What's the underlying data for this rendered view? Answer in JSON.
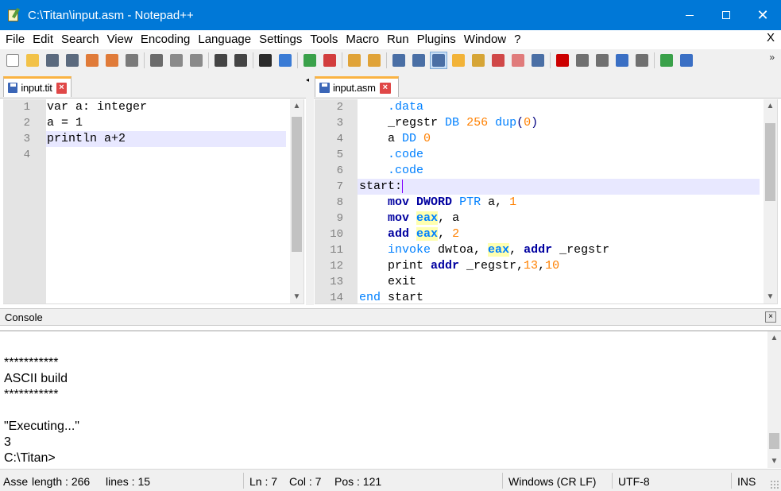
{
  "window": {
    "title": "C:\\Titan\\input.asm - Notepad++"
  },
  "menu": [
    "File",
    "Edit",
    "Search",
    "View",
    "Encoding",
    "Language",
    "Settings",
    "Tools",
    "Macro",
    "Run",
    "Plugins",
    "Window",
    "?"
  ],
  "menu_close": "X",
  "toolbar": {
    "more": "»",
    "buttons": [
      {
        "name": "new-file-icon",
        "color": "#ffffff"
      },
      {
        "name": "open-file-icon",
        "color": "#f2c248"
      },
      {
        "name": "save-icon",
        "color": "#5b6a7e"
      },
      {
        "name": "save-all-icon",
        "color": "#5b6a7e"
      },
      {
        "name": "close-icon",
        "color": "#e07b39"
      },
      {
        "name": "close-all-icon",
        "color": "#e07b39"
      },
      {
        "name": "print-icon",
        "color": "#7a7a7a"
      },
      {
        "name": "cut-icon",
        "color": "#6b6b6b"
      },
      {
        "name": "copy-icon",
        "color": "#8a8a8a"
      },
      {
        "name": "paste-icon",
        "color": "#8a8a8a"
      },
      {
        "name": "undo-icon",
        "color": "#444444"
      },
      {
        "name": "redo-icon",
        "color": "#444444"
      },
      {
        "name": "find-icon",
        "color": "#2b2b2b"
      },
      {
        "name": "replace-icon",
        "color": "#3a7bd5"
      },
      {
        "name": "zoom-in-icon",
        "color": "#3aa14a"
      },
      {
        "name": "zoom-out-icon",
        "color": "#d23d3d"
      },
      {
        "name": "sync-vertical-icon",
        "color": "#e0a338"
      },
      {
        "name": "sync-horizontal-icon",
        "color": "#e0a338"
      },
      {
        "name": "word-wrap-icon",
        "color": "#4a6fa5"
      },
      {
        "name": "show-all-characters-icon",
        "color": "#4a6fa5"
      },
      {
        "name": "indent-guide-icon",
        "color": "#4a6fa5"
      },
      {
        "name": "doc-map-icon",
        "color": "#f2b338"
      },
      {
        "name": "function-list-icon",
        "color": "#d6a536"
      },
      {
        "name": "udl-icon",
        "color": "#d04848"
      },
      {
        "name": "folder-workspace-icon",
        "color": "#e07b7b"
      },
      {
        "name": "monitoring-icon",
        "color": "#4a6fa5"
      },
      {
        "name": "record-macro-icon",
        "color": "#cc0000"
      },
      {
        "name": "stop-macro-icon",
        "color": "#707070"
      },
      {
        "name": "play-macro-icon",
        "color": "#707070"
      },
      {
        "name": "run-macro-multiple-icon",
        "color": "#3a6fc4"
      },
      {
        "name": "save-macro-icon",
        "color": "#707070"
      },
      {
        "name": "run-icon",
        "color": "#3aa14a"
      },
      {
        "name": "plugin-icon",
        "color": "#3a6fc4"
      }
    ]
  },
  "left_tab": {
    "label": "input.tit",
    "close": "×"
  },
  "right_tab": {
    "label": "input.asm",
    "close": "×"
  },
  "left_editor": {
    "lines": [
      {
        "n": "1",
        "text": "var a: integer"
      },
      {
        "n": "2",
        "text": "a = 1"
      },
      {
        "n": "3",
        "text": "println a+2"
      },
      {
        "n": "4",
        "text": ""
      }
    ]
  },
  "right_editor": {
    "lines": [
      {
        "n": "2",
        "tokens": [
          {
            "t": "    "
          },
          {
            "t": ".data",
            "c": "kw-blue"
          }
        ]
      },
      {
        "n": "3",
        "tokens": [
          {
            "t": "    _regstr "
          },
          {
            "t": "DB",
            "c": "kw-blue"
          },
          {
            "t": " "
          },
          {
            "t": "256",
            "c": "num"
          },
          {
            "t": " "
          },
          {
            "t": "dup",
            "c": "kw-blue"
          },
          {
            "t": "(",
            "c": "punct"
          },
          {
            "t": "0",
            "c": "num"
          },
          {
            "t": ")",
            "c": "punct"
          }
        ]
      },
      {
        "n": "4",
        "tokens": [
          {
            "t": "    a "
          },
          {
            "t": "DD",
            "c": "kw-blue"
          },
          {
            "t": " "
          },
          {
            "t": "0",
            "c": "num"
          }
        ]
      },
      {
        "n": "5",
        "tokens": [
          {
            "t": "    "
          },
          {
            "t": ".code",
            "c": "kw-blue"
          }
        ]
      },
      {
        "n": "6",
        "tokens": [
          {
            "t": "    "
          },
          {
            "t": ".code",
            "c": "kw-blue"
          }
        ]
      },
      {
        "n": "7",
        "tokens": [
          {
            "t": "start:"
          }
        ]
      },
      {
        "n": "8",
        "tokens": [
          {
            "t": "    "
          },
          {
            "t": "mov",
            "c": "kw-bold"
          },
          {
            "t": " "
          },
          {
            "t": "DWORD",
            "c": "kw-bold"
          },
          {
            "t": " "
          },
          {
            "t": "PTR",
            "c": "kw-blue"
          },
          {
            "t": " a, "
          },
          {
            "t": "1",
            "c": "num"
          }
        ]
      },
      {
        "n": "9",
        "tokens": [
          {
            "t": "    "
          },
          {
            "t": "mov",
            "c": "kw-bold"
          },
          {
            "t": " "
          },
          {
            "t": "eax",
            "c": "reg"
          },
          {
            "t": ", a"
          }
        ]
      },
      {
        "n": "10",
        "tokens": [
          {
            "t": "    "
          },
          {
            "t": "add",
            "c": "kw-bold"
          },
          {
            "t": " "
          },
          {
            "t": "eax",
            "c": "reg"
          },
          {
            "t": ", "
          },
          {
            "t": "2",
            "c": "num"
          }
        ]
      },
      {
        "n": "11",
        "tokens": [
          {
            "t": "    "
          },
          {
            "t": "invoke",
            "c": "kw-blue"
          },
          {
            "t": " dwtoa, "
          },
          {
            "t": "eax",
            "c": "reg"
          },
          {
            "t": ", "
          },
          {
            "t": "addr",
            "c": "kw-bold"
          },
          {
            "t": " _regstr"
          }
        ]
      },
      {
        "n": "12",
        "tokens": [
          {
            "t": "    print "
          },
          {
            "t": "addr",
            "c": "kw-bold"
          },
          {
            "t": " _regstr,"
          },
          {
            "t": "13",
            "c": "num"
          },
          {
            "t": ","
          },
          {
            "t": "10",
            "c": "num"
          }
        ]
      },
      {
        "n": "13",
        "tokens": [
          {
            "t": "    exit"
          }
        ]
      },
      {
        "n": "14",
        "tokens": [
          {
            "t": "end",
            "c": "kw-blue"
          },
          {
            "t": " start"
          }
        ]
      }
    ]
  },
  "console": {
    "title": "Console",
    "close": "×",
    "lines": [
      "",
      "***********",
      "ASCII build",
      "***********",
      "",
      "\"Executing...\"",
      "3",
      "C:\\Titan>"
    ]
  },
  "status": {
    "language": "Assembly language source file",
    "length": "length : 266",
    "lines": "lines : 15",
    "ln": "Ln : 7",
    "col": "Col : 7",
    "pos": "Pos : 121",
    "eol": "Windows (CR LF)",
    "encoding": "UTF-8",
    "mode": "INS"
  }
}
